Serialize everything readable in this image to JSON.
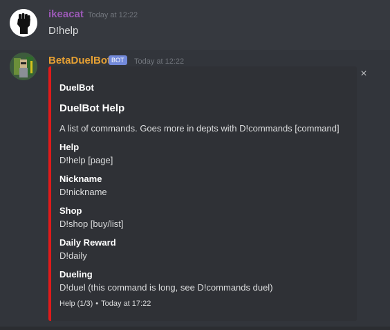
{
  "messages": [
    {
      "username": "ikeacat",
      "timestamp": "Today at 12:22",
      "content": "D!help"
    },
    {
      "username": "BetaDuelBot",
      "bot_tag": "BOT",
      "timestamp": "Today at 12:22",
      "embed": {
        "author": "DuelBot",
        "title": "DuelBot Help",
        "description": "A list of commands. Goes more in depts with D!commands [command]",
        "fields": [
          {
            "name": "Help",
            "value": "D!help [page]"
          },
          {
            "name": "Nickname",
            "value": "D!nickname"
          },
          {
            "name": "Shop",
            "value": "D!shop [buy/list]"
          },
          {
            "name": "Daily Reward",
            "value": "D!daily"
          },
          {
            "name": "Dueling",
            "value": "D!duel (this command is long, see D!commands duel)"
          }
        ],
        "footer_text": "Help (1/3)",
        "footer_separator": "•",
        "footer_time": "Today at 17:22",
        "accent_color": "#e01a1a"
      }
    }
  ],
  "close_symbol": "×",
  "colors": {
    "background": "#36393f",
    "username_user": "#9b59b6",
    "username_bot": "#e6a033",
    "bot_tag": "#7289da"
  }
}
